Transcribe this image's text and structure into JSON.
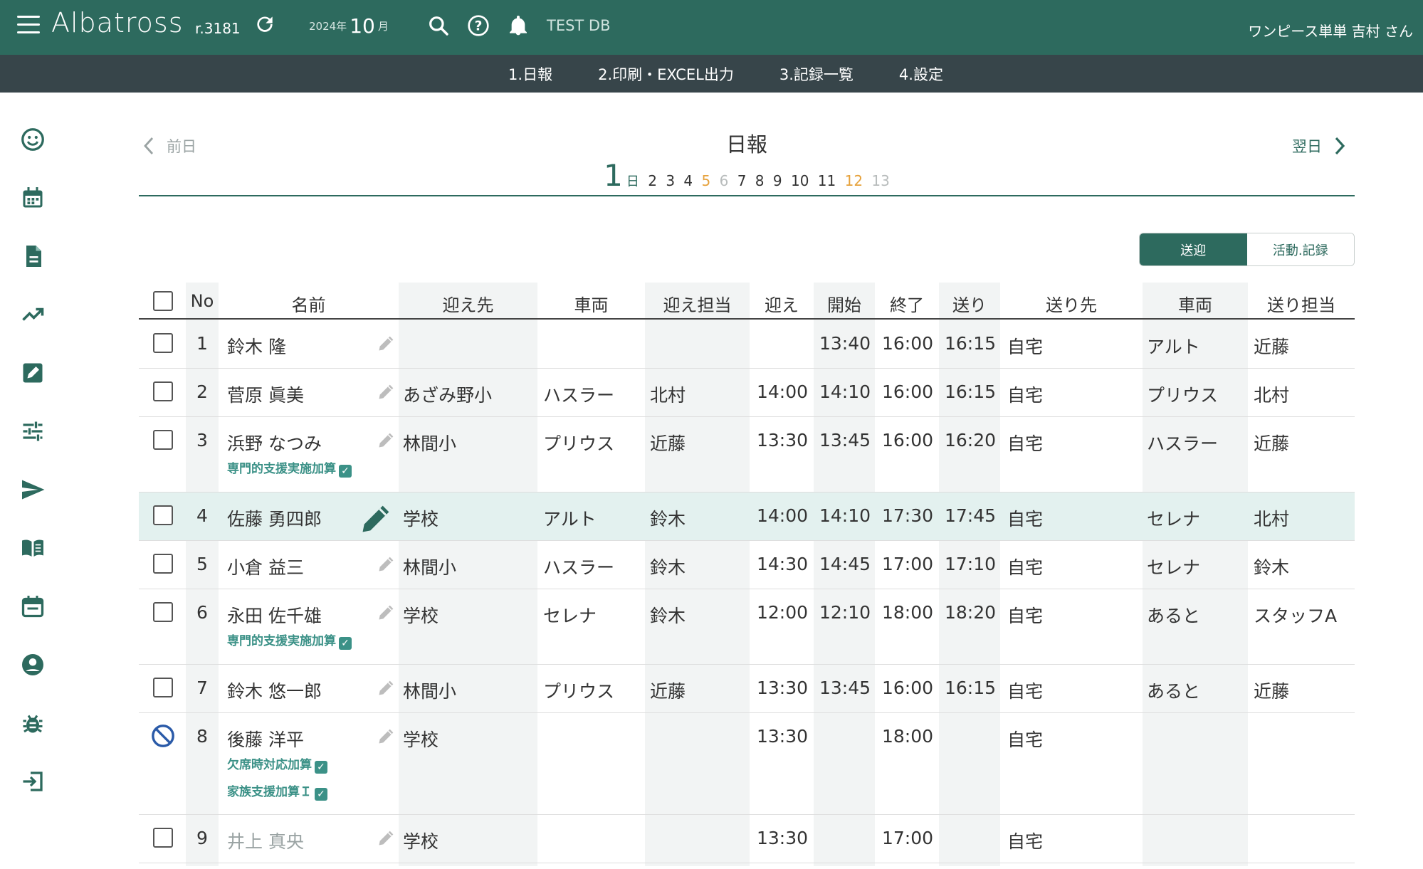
{
  "header": {
    "app_name": "Albatross",
    "revision": "r.3181",
    "year_label": "2024年",
    "month": "10",
    "month_unit": "月",
    "db_name": "TEST DB",
    "user": "ワンピース単単 吉村 さん"
  },
  "nav": [
    "1.日報",
    "2.印刷・EXCEL出力",
    "3.記録一覧",
    "4.設定"
  ],
  "sidebar_icons": [
    "smiley-icon",
    "calendar-icon",
    "document-icon",
    "trend-icon",
    "edit-icon",
    "sliders-icon",
    "send-icon",
    "book-icon",
    "event-icon",
    "account-icon",
    "bug-icon",
    "logout-icon"
  ],
  "page": {
    "title": "日報",
    "prev_label": "前日",
    "next_label": "翌日",
    "current_day": "1",
    "current_day_unit": "日",
    "days": [
      "2",
      "3",
      "4",
      "5",
      "6",
      "7",
      "8",
      "9",
      "10",
      "11",
      "12",
      "13"
    ],
    "toggle": {
      "left": "送迎",
      "right": "活動.記録"
    }
  },
  "table": {
    "headers": [
      "No",
      "名前",
      "迎え先",
      "車両",
      "迎え担当",
      "迎え",
      "開始",
      "終了",
      "送り",
      "送り先",
      "車両",
      "送り担当"
    ],
    "rows": [
      {
        "no": "1",
        "name": "鈴木 隆",
        "pickup_place": "",
        "car1": "",
        "pickup_staff": "",
        "pickup": "",
        "start": "13:40",
        "end": "16:00",
        "send": "16:15",
        "dest": "自宅",
        "car2": "アルト",
        "send_staff": "近藤",
        "addons": []
      },
      {
        "no": "2",
        "name": "菅原 眞美",
        "pickup_place": "あざみ野小",
        "car1": "ハスラー",
        "pickup_staff": "北村",
        "pickup": "14:00",
        "start": "14:10",
        "end": "16:00",
        "send": "16:15",
        "dest": "自宅",
        "car2": "プリウス",
        "send_staff": "北村",
        "addons": []
      },
      {
        "no": "3",
        "name": "浜野 なつみ",
        "pickup_place": "林間小",
        "car1": "プリウス",
        "pickup_staff": "近藤",
        "pickup": "13:30",
        "start": "13:45",
        "end": "16:00",
        "send": "16:20",
        "dest": "自宅",
        "car2": "ハスラー",
        "send_staff": "近藤",
        "addons": [
          "専門的支援実施加算"
        ]
      },
      {
        "no": "4",
        "name": "佐藤 勇四郎",
        "pickup_place": "学校",
        "car1": "アルト",
        "pickup_staff": "鈴木",
        "pickup": "14:00",
        "start": "14:10",
        "end": "17:30",
        "send": "17:45",
        "dest": "自宅",
        "car2": "セレナ",
        "send_staff": "北村",
        "addons": []
      },
      {
        "no": "5",
        "name": "小倉 益三",
        "pickup_place": "林間小",
        "car1": "ハスラー",
        "pickup_staff": "鈴木",
        "pickup": "14:30",
        "start": "14:45",
        "end": "17:00",
        "send": "17:10",
        "dest": "自宅",
        "car2": "セレナ",
        "send_staff": "鈴木",
        "addons": []
      },
      {
        "no": "6",
        "name": "永田 佐千雄",
        "pickup_place": "学校",
        "car1": "セレナ",
        "pickup_staff": "鈴木",
        "pickup": "12:00",
        "start": "12:10",
        "end": "18:00",
        "send": "18:20",
        "dest": "自宅",
        "car2": "あると",
        "send_staff": "スタッフA",
        "addons": [
          "専門的支援実施加算"
        ]
      },
      {
        "no": "7",
        "name": "鈴木 悠一郎",
        "pickup_place": "林間小",
        "car1": "プリウス",
        "pickup_staff": "近藤",
        "pickup": "13:30",
        "start": "13:45",
        "end": "16:00",
        "send": "16:15",
        "dest": "自宅",
        "car2": "あると",
        "send_staff": "近藤",
        "addons": []
      },
      {
        "no": "8",
        "name": "後藤 洋平",
        "pickup_place": "学校",
        "car1": "",
        "pickup_staff": "",
        "pickup": "13:30",
        "start": "",
        "end": "18:00",
        "send": "",
        "dest": "自宅",
        "car2": "",
        "send_staff": "",
        "addons": [
          "欠席時対応加算",
          "家族支援加算Ｉ"
        ]
      },
      {
        "no": "9",
        "name": "井上 真央",
        "pickup_place": "学校",
        "car1": "",
        "pickup_staff": "",
        "pickup": "13:30",
        "start": "",
        "end": "17:00",
        "send": "",
        "dest": "自宅",
        "car2": "",
        "send_staff": "",
        "addons": []
      }
    ]
  },
  "colors": {
    "brand": "#2d6a5e",
    "nav": "#37454a",
    "accent_addon": "#3b9187",
    "highlight_row": "#e3f1ef"
  }
}
